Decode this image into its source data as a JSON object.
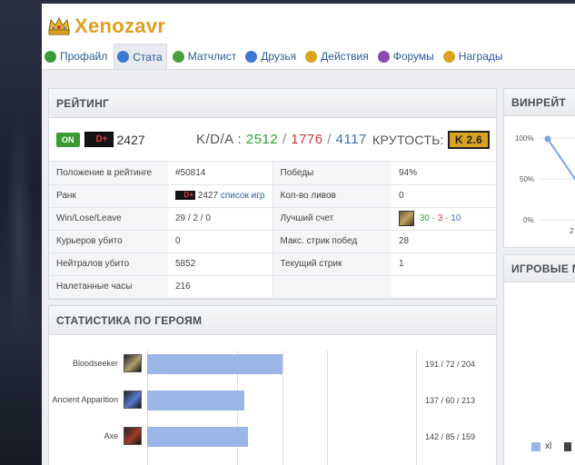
{
  "header": {
    "username": "Xenozavr",
    "crown_icon": "crown-icon"
  },
  "tabs": [
    {
      "label": "Профайл",
      "icon": "profile-icon",
      "color": "#3a9a3a",
      "active": false
    },
    {
      "label": "Стата",
      "icon": "info-icon",
      "color": "#3a7ad0",
      "active": true
    },
    {
      "label": "Матчлист",
      "icon": "globe-icon",
      "color": "#4aa040",
      "active": false
    },
    {
      "label": "Друзья",
      "icon": "friends-icon",
      "color": "#3a7ad0",
      "active": false
    },
    {
      "label": "Действия",
      "icon": "actions-icon",
      "color": "#d9a320",
      "active": false
    },
    {
      "label": "Форумы",
      "icon": "forums-icon",
      "color": "#8a4ab0",
      "active": false
    },
    {
      "label": "Награды",
      "icon": "awards-icon",
      "color": "#d9a320",
      "active": false
    }
  ],
  "rating": {
    "title": "РЕЙТИНГ",
    "status": "ON",
    "rank": "D+",
    "mmr": "2427",
    "kda_label": "K/D/A :",
    "kills": "2512",
    "deaths": "1776",
    "assists": "4117",
    "slash": "/",
    "coolness_label": "КРУТОСТЬ:",
    "coolness_value": "K 2.6",
    "rows": [
      {
        "l1": "Положение в рейтинге",
        "v1": "#50814",
        "l2": "Победы",
        "v2": "94%"
      },
      {
        "l1": "Ранк",
        "v1_rank": "D+",
        "v1_mmr": "2427",
        "v1_link": "список игр",
        "l2": "Кол-во ливов",
        "v2": "0"
      },
      {
        "l1": "Win/Lose/Leave",
        "v1": "29 / 2 / 0",
        "l2": "Лучший счет",
        "best_k": "30",
        "best_d": "3",
        "best_a": "10",
        "dash": "-"
      },
      {
        "l1": "Курьеров убито",
        "v1": "0",
        "l2": "Макс. стрик побед",
        "v2": "28"
      },
      {
        "l1": "Нейтралов убито",
        "v1": "5852",
        "l2": "Текущий стрик",
        "v2": "1"
      },
      {
        "l1": "Налетанные часы",
        "v1": "216",
        "l2": "",
        "v2": ""
      }
    ]
  },
  "heroes": {
    "title": "СТАТИСТИКА ПО ГЕРОЯМ",
    "chart_data": {
      "type": "bar",
      "categories": [
        "Bloodseeker",
        "Ancient Apparition",
        "Axe"
      ],
      "values": [
        191,
        137,
        142
      ],
      "labels": [
        "191 / 72 / 204",
        "137 / 60 / 213",
        "142 / 85 / 159"
      ],
      "icon_colors": [
        "#b0a070",
        "#5a7ad0",
        "#a03a2a"
      ]
    }
  },
  "winrate": {
    "title": "ВИНРЕЙТ",
    "y_labels": [
      "100%",
      "50%",
      "0%"
    ],
    "x_label_partial": "2",
    "line_color": "#9bb5e6"
  },
  "games": {
    "title": "ИГРОВЫЕ М",
    "legend_label": "xl"
  }
}
